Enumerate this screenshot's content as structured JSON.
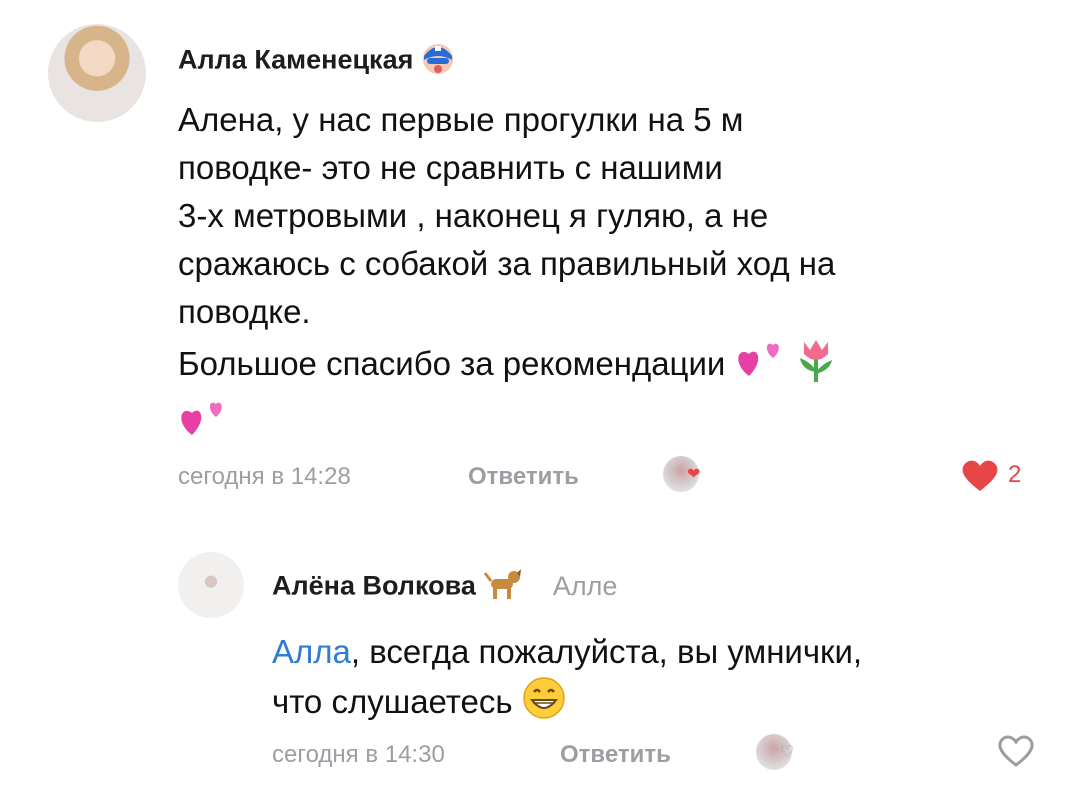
{
  "comments": [
    {
      "author": "Алла Каменецкая",
      "badge_icon": "superhero-face-icon",
      "text_lines": [
        "Алена, у нас первые прогулки на 5 м",
        "поводке- это не сравнить с нашими",
        "3-х метровыми , наконец я гуляю, а не",
        "сражаюсь с собакой за правильный ход на",
        "поводке.",
        "Большое спасибо за рекомендации"
      ],
      "time": "сегодня в 14:28",
      "reply_label": "Ответить",
      "like_count": "2",
      "liked": true,
      "accent_color": "#e64646"
    },
    {
      "author": "Алёна Волкова",
      "badge_icon": "dog-icon",
      "reply_to": "Алле",
      "mention": "Алла",
      "text_rest": ", всегда пожалуйста, вы умнички,",
      "text_line2": "что слушаетесь",
      "time": "сегодня в 14:30",
      "reply_label": "Ответить",
      "liked": false,
      "mention_color": "#2e7dd6"
    }
  ]
}
